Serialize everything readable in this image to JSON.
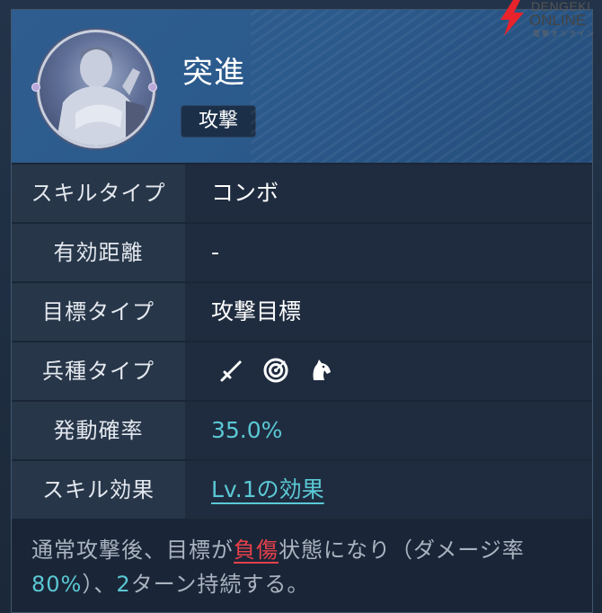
{
  "skill": {
    "name": "突進",
    "category": "攻撃"
  },
  "watermark": {
    "line1": "DENGEKI",
    "line2": "ONLINE",
    "line3": "電撃オンライン"
  },
  "rows": [
    {
      "label": "スキルタイプ",
      "value": "コンボ"
    },
    {
      "label": "有効距離",
      "value": "-"
    },
    {
      "label": "目標タイプ",
      "value": "攻撃目標"
    },
    {
      "label": "兵種タイプ",
      "icons": [
        "sword-icon",
        "archery-target-icon",
        "horse-head-icon"
      ]
    },
    {
      "label": "発動確率",
      "value": "35.0%"
    },
    {
      "label": "スキル効果",
      "value": "Lv.1の効果"
    }
  ],
  "description": {
    "part1": "通常攻撃後、目標が",
    "status": "負傷",
    "part2": "状態になり（ダメージ率",
    "rate": "80%",
    "part3": "）、",
    "turns": "2",
    "part4": "ターン持続する。"
  },
  "colors": {
    "header": "#2f5d8f",
    "accent": "#5bc8d5",
    "status_red": "#e8404a",
    "label_bg": "#273649"
  }
}
